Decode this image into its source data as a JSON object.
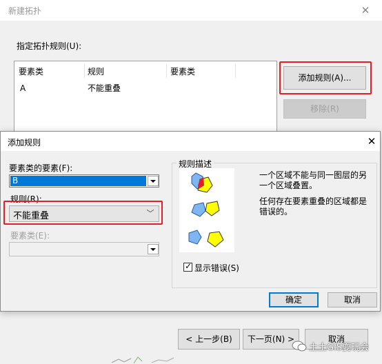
{
  "background_dialog": {
    "title": "新建拓扑",
    "close_glyph": "✕",
    "rules_label": "指定拓扑规则(U):",
    "table_headers": [
      "要素类",
      "规则",
      "要素类"
    ],
    "rows": [
      {
        "feature_class": "A",
        "rule": "不能重叠",
        "feature_class_2": ""
      }
    ],
    "add_rule_button": "添加规则(A)...",
    "remove_button": "移除(R)",
    "back_button": "< 上一步(B)",
    "next_button": "下一页(N) >",
    "cancel_button": "取消"
  },
  "add_rule_dialog": {
    "title": "添加规则",
    "close_glyph": "✕",
    "feature_label": "要素类的要素(F):",
    "feature_value": "B",
    "rule_label": "规则(R):",
    "rule_value": "不能重叠",
    "feature_class_label": "要素类(E):",
    "feature_class_value": "",
    "description_group_label": "规则描述",
    "description_line_1": "一个区域不能与同一图层的另一个区域叠置。",
    "description_line_2": "任何存在要素重叠的区域都是错误的。",
    "show_errors_label": "显示错误(S)",
    "show_errors_checked": true,
    "check_glyph": "✓",
    "ok_button": "确定",
    "cancel_button": "取消"
  },
  "watermark": {
    "text": "土土GIS耍玩会"
  },
  "colors": {
    "highlight": "#e31e25",
    "selection": "#0078d7",
    "polygon_blue": "#7fb5f0",
    "polygon_yellow": "#ffff00",
    "error_red": "#e31e25"
  }
}
